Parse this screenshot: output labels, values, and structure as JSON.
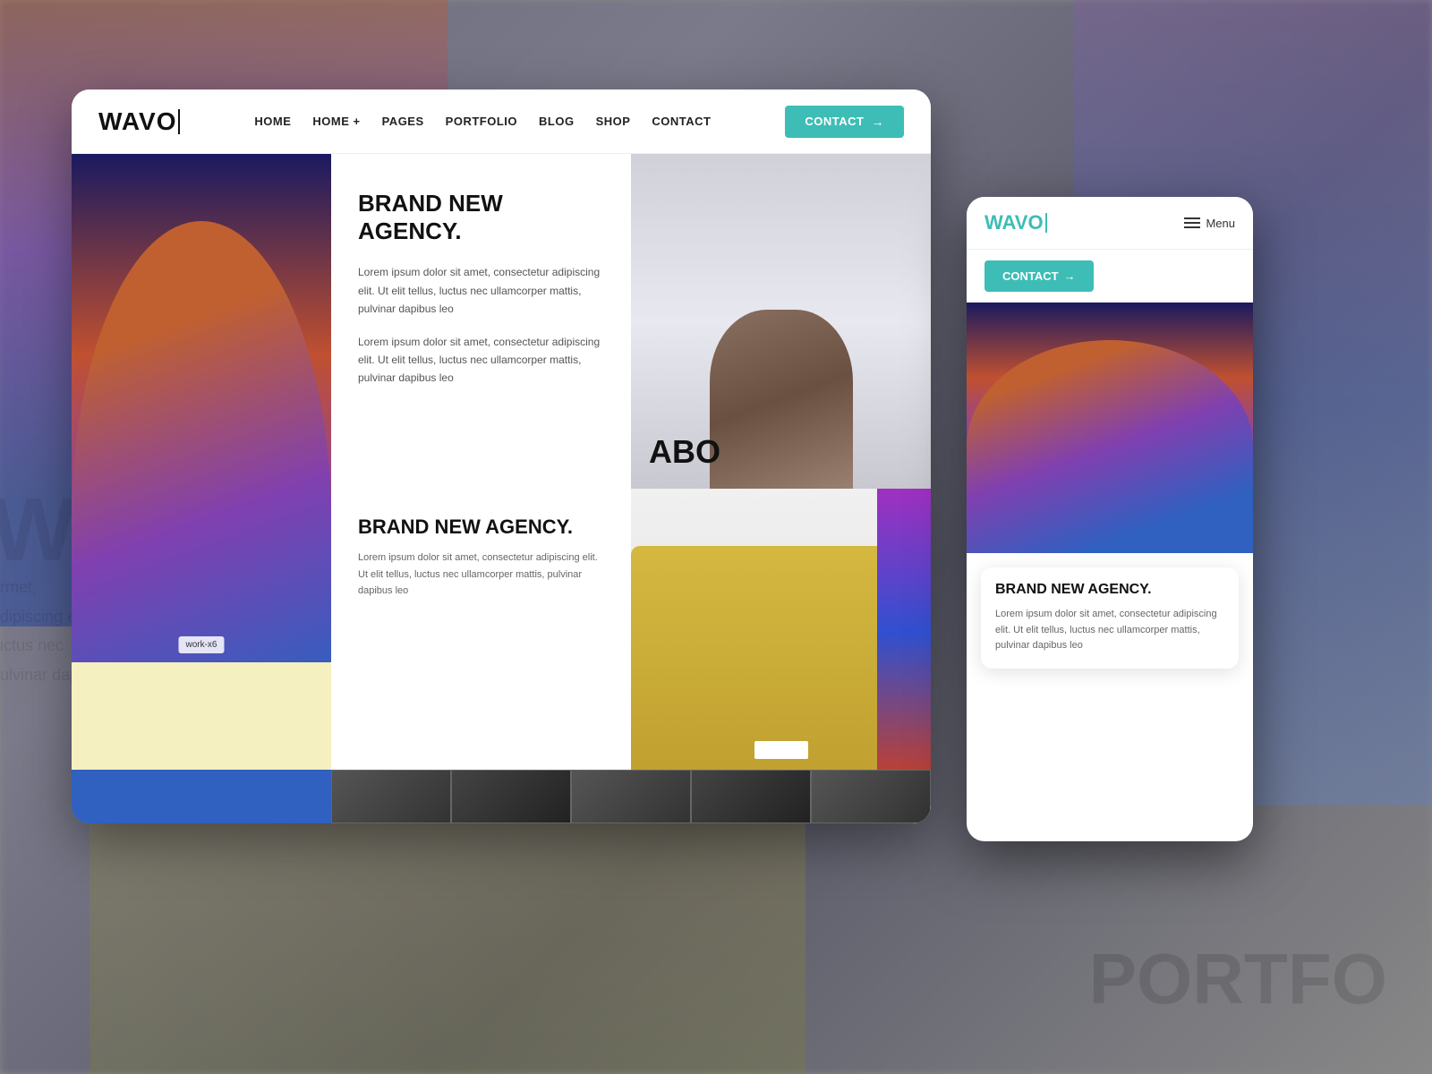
{
  "background": {
    "brand_text": "W AG",
    "agency_lines": [
      "armet,",
      "adipiscing elit.",
      "luctus nec",
      "pulvinar dapibus leo"
    ],
    "portfolio_text": "PORTFO"
  },
  "desktop_mockup": {
    "nav": {
      "logo": "WAVO",
      "links": [
        "HOME",
        "HOME +",
        "PAGES",
        "PORTFOLIO",
        "BLOG",
        "SHOP",
        "CONTACT"
      ],
      "contact_button": "CONTACT",
      "contact_arrow": "→"
    },
    "hero": {
      "work_badge": "work-x6",
      "title": "BRAND NEW AGENCY.",
      "paragraph1": "Lorem ipsum dolor sit amet, consectetur adipiscing elit. Ut elit tellus, luctus nec ullamcorper mattis, pulvinar dapibus leo",
      "paragraph2": "Lorem ipsum dolor sit amet, consectetur adipiscing elit. Ut elit tellus, luctus nec ullamcorper mattis, pulvinar dapibus leo",
      "about_label": "ABO"
    },
    "bottom_left": {
      "title": "BRAND NEW AGENCY.",
      "body": "Lorem ipsum dolor sit amet, consectetur adipiscing elit. Ut elit tellus, luctus nec ullamcorper mattis, pulvinar dapibus leo"
    },
    "portfolio": {
      "label": "PORTFOLIO"
    }
  },
  "mobile_mockup": {
    "nav": {
      "logo": "WAVO",
      "menu_label": "Menu",
      "contact_button": "CONTACT",
      "contact_arrow": "→"
    },
    "card": {
      "title": "BRAND NEW AGENCY.",
      "body": "Lorem ipsum dolor sit amet, consectetur adipiscing elit. Ut elit tellus, luctus nec ullamcorper mattis, pulvinar dapibus leo"
    }
  },
  "colors": {
    "accent": "#3dbdb5",
    "dark": "#111111",
    "text": "#555555",
    "light_bg": "#f5f5f5"
  }
}
